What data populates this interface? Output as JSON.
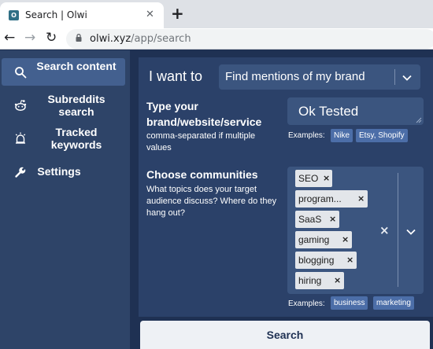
{
  "browser": {
    "tab_title": "Search | Olwi",
    "favicon_letter": "O",
    "close_glyph": "✕",
    "newtab_glyph": "+",
    "url_host": "olwi.xyz",
    "url_path": "/app/search",
    "back_glyph": "←",
    "forward_glyph": "→",
    "reload_glyph": "↻"
  },
  "sidebar": {
    "items": [
      {
        "label": "Search content",
        "icon": "search-icon",
        "active": true
      },
      {
        "label": "Subreddits search",
        "icon": "reddit-icon",
        "active": false
      },
      {
        "label": "Tracked keywords",
        "icon": "alarm-icon",
        "active": false
      },
      {
        "label": "Settings",
        "icon": "wrench-icon",
        "active": false
      }
    ]
  },
  "main": {
    "intent_label": "I want to",
    "intent_value": "Find mentions of my brand",
    "brand": {
      "title": "Type your brand/website/service",
      "hint": "comma-separated if multiple values",
      "value": "Ok Tested",
      "examples_label": "Examples:",
      "examples": [
        "Nike",
        "Etsy, Shopify"
      ]
    },
    "communities": {
      "title": "Choose communities",
      "hint": "What topics does your target audience discuss? Where do they hang out?",
      "tags": [
        "SEO",
        "program...",
        "SaaS",
        "gaming",
        "blogging",
        "hiring"
      ],
      "remove_glyph": "×",
      "clear_glyph": "×",
      "examples_label": "Examples:",
      "examples": [
        "business",
        "marketing"
      ]
    },
    "search_label": "Search"
  },
  "colors": {
    "page_bg": "#1f3153",
    "sidebar_bg": "#2e4468",
    "sidebar_active": "#43608f",
    "panel_bg": "#2b4169",
    "input_bg": "#3b557f",
    "chip_bg": "#4c6ea8",
    "tag_bg": "#e3e6ea"
  }
}
